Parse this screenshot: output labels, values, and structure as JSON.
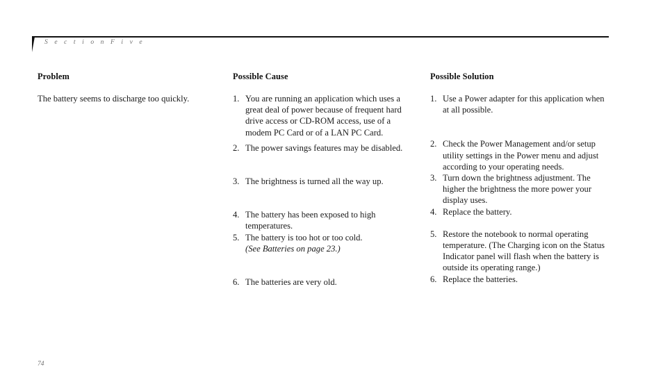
{
  "header": {
    "section_label": "S e c t i o n      F i v e",
    "section_label_plain": "Section Five",
    "wedge_icon": "wedge-marker-icon",
    "rule_color": "#111111"
  },
  "columns": {
    "problem": {
      "heading": "Problem",
      "body": "The battery seems to discharge too quickly."
    },
    "possible_cause": {
      "heading": "Possible Cause",
      "items": [
        {
          "number": "1.",
          "text": "You are running an application which uses a great deal of power because of frequent hard drive access or CD-ROM access, use of a modem PC Card or of a LAN PC Card.",
          "gap_after": 6
        },
        {
          "number": "2.",
          "text": "The power savings features may be disabled.",
          "gap_after": 32
        },
        {
          "number": "3.",
          "text": "The brightness is turned all the way up.",
          "gap_after": 32
        },
        {
          "number": "4.",
          "text": "The battery has been exposed to high temperatures.",
          "gap_after": 0
        },
        {
          "number": "5.",
          "text": "The battery is too hot or too cold.",
          "xref": "(See Batteries on page 23.)",
          "gap_after": 32
        },
        {
          "number": "6.",
          "text": "The batteries are very old.",
          "gap_after": 0
        }
      ]
    },
    "possible_solution": {
      "heading": "Possible Solution",
      "items": [
        {
          "number": "1.",
          "text": "Use a Power adapter for this application when at all possible.",
          "gap_after": 33
        },
        {
          "number": "2.",
          "text": "Check the Power Management and/or setup utility settings in the Power menu  and adjust according to your operating needs.",
          "gap_after": 0
        },
        {
          "number": "3.",
          "text": "Turn down the brightness adjustment. The higher the brightness the more power your display uses.",
          "gap_after": 0
        },
        {
          "number": "4.",
          "text": "Replace the battery.",
          "gap_after": 16
        },
        {
          "number": "5.",
          "text": "Restore the notebook to normal operating temperature. (The Charging icon on the Status Indicator panel will flash when the battery is outside its operating range.)",
          "gap_after": 0
        },
        {
          "number": "6.",
          "text": "Replace the batteries.",
          "gap_after": 0
        }
      ]
    }
  },
  "footer": {
    "page_number": "74"
  }
}
